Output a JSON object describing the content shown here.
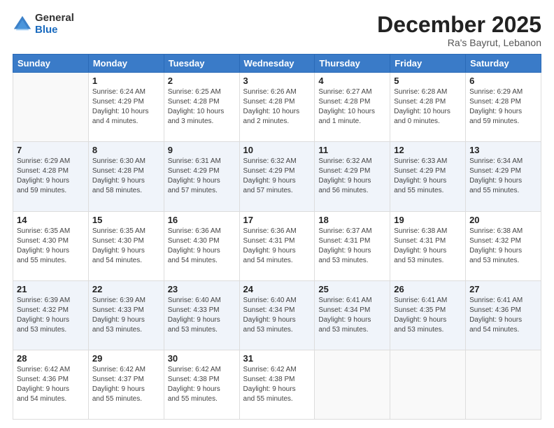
{
  "logo": {
    "general": "General",
    "blue": "Blue"
  },
  "header": {
    "month": "December 2025",
    "location": "Ra's Bayrut, Lebanon"
  },
  "weekdays": [
    "Sunday",
    "Monday",
    "Tuesday",
    "Wednesday",
    "Thursday",
    "Friday",
    "Saturday"
  ],
  "weeks": [
    [
      {
        "day": "",
        "info": ""
      },
      {
        "day": "1",
        "info": "Sunrise: 6:24 AM\nSunset: 4:29 PM\nDaylight: 10 hours\nand 4 minutes."
      },
      {
        "day": "2",
        "info": "Sunrise: 6:25 AM\nSunset: 4:28 PM\nDaylight: 10 hours\nand 3 minutes."
      },
      {
        "day": "3",
        "info": "Sunrise: 6:26 AM\nSunset: 4:28 PM\nDaylight: 10 hours\nand 2 minutes."
      },
      {
        "day": "4",
        "info": "Sunrise: 6:27 AM\nSunset: 4:28 PM\nDaylight: 10 hours\nand 1 minute."
      },
      {
        "day": "5",
        "info": "Sunrise: 6:28 AM\nSunset: 4:28 PM\nDaylight: 10 hours\nand 0 minutes."
      },
      {
        "day": "6",
        "info": "Sunrise: 6:29 AM\nSunset: 4:28 PM\nDaylight: 9 hours\nand 59 minutes."
      }
    ],
    [
      {
        "day": "7",
        "info": "Sunrise: 6:29 AM\nSunset: 4:28 PM\nDaylight: 9 hours\nand 59 minutes."
      },
      {
        "day": "8",
        "info": "Sunrise: 6:30 AM\nSunset: 4:28 PM\nDaylight: 9 hours\nand 58 minutes."
      },
      {
        "day": "9",
        "info": "Sunrise: 6:31 AM\nSunset: 4:29 PM\nDaylight: 9 hours\nand 57 minutes."
      },
      {
        "day": "10",
        "info": "Sunrise: 6:32 AM\nSunset: 4:29 PM\nDaylight: 9 hours\nand 57 minutes."
      },
      {
        "day": "11",
        "info": "Sunrise: 6:32 AM\nSunset: 4:29 PM\nDaylight: 9 hours\nand 56 minutes."
      },
      {
        "day": "12",
        "info": "Sunrise: 6:33 AM\nSunset: 4:29 PM\nDaylight: 9 hours\nand 55 minutes."
      },
      {
        "day": "13",
        "info": "Sunrise: 6:34 AM\nSunset: 4:29 PM\nDaylight: 9 hours\nand 55 minutes."
      }
    ],
    [
      {
        "day": "14",
        "info": "Sunrise: 6:35 AM\nSunset: 4:30 PM\nDaylight: 9 hours\nand 55 minutes."
      },
      {
        "day": "15",
        "info": "Sunrise: 6:35 AM\nSunset: 4:30 PM\nDaylight: 9 hours\nand 54 minutes."
      },
      {
        "day": "16",
        "info": "Sunrise: 6:36 AM\nSunset: 4:30 PM\nDaylight: 9 hours\nand 54 minutes."
      },
      {
        "day": "17",
        "info": "Sunrise: 6:36 AM\nSunset: 4:31 PM\nDaylight: 9 hours\nand 54 minutes."
      },
      {
        "day": "18",
        "info": "Sunrise: 6:37 AM\nSunset: 4:31 PM\nDaylight: 9 hours\nand 53 minutes."
      },
      {
        "day": "19",
        "info": "Sunrise: 6:38 AM\nSunset: 4:31 PM\nDaylight: 9 hours\nand 53 minutes."
      },
      {
        "day": "20",
        "info": "Sunrise: 6:38 AM\nSunset: 4:32 PM\nDaylight: 9 hours\nand 53 minutes."
      }
    ],
    [
      {
        "day": "21",
        "info": "Sunrise: 6:39 AM\nSunset: 4:32 PM\nDaylight: 9 hours\nand 53 minutes."
      },
      {
        "day": "22",
        "info": "Sunrise: 6:39 AM\nSunset: 4:33 PM\nDaylight: 9 hours\nand 53 minutes."
      },
      {
        "day": "23",
        "info": "Sunrise: 6:40 AM\nSunset: 4:33 PM\nDaylight: 9 hours\nand 53 minutes."
      },
      {
        "day": "24",
        "info": "Sunrise: 6:40 AM\nSunset: 4:34 PM\nDaylight: 9 hours\nand 53 minutes."
      },
      {
        "day": "25",
        "info": "Sunrise: 6:41 AM\nSunset: 4:34 PM\nDaylight: 9 hours\nand 53 minutes."
      },
      {
        "day": "26",
        "info": "Sunrise: 6:41 AM\nSunset: 4:35 PM\nDaylight: 9 hours\nand 53 minutes."
      },
      {
        "day": "27",
        "info": "Sunrise: 6:41 AM\nSunset: 4:36 PM\nDaylight: 9 hours\nand 54 minutes."
      }
    ],
    [
      {
        "day": "28",
        "info": "Sunrise: 6:42 AM\nSunset: 4:36 PM\nDaylight: 9 hours\nand 54 minutes."
      },
      {
        "day": "29",
        "info": "Sunrise: 6:42 AM\nSunset: 4:37 PM\nDaylight: 9 hours\nand 55 minutes."
      },
      {
        "day": "30",
        "info": "Sunrise: 6:42 AM\nSunset: 4:38 PM\nDaylight: 9 hours\nand 55 minutes."
      },
      {
        "day": "31",
        "info": "Sunrise: 6:42 AM\nSunset: 4:38 PM\nDaylight: 9 hours\nand 55 minutes."
      },
      {
        "day": "",
        "info": ""
      },
      {
        "day": "",
        "info": ""
      },
      {
        "day": "",
        "info": ""
      }
    ]
  ]
}
